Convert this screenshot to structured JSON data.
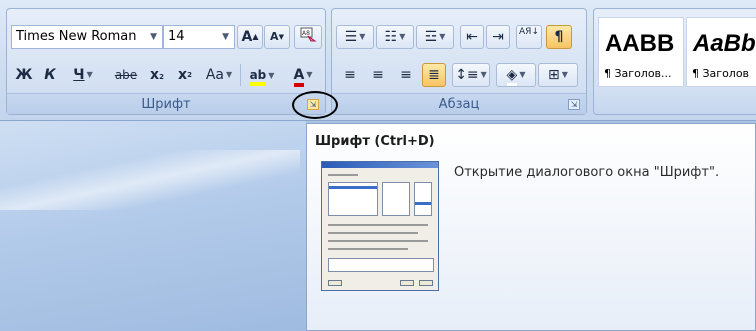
{
  "font_group": {
    "label": "Шрифт",
    "font_name": "Times New Roman",
    "font_size": "14",
    "grow_font": "A",
    "shrink_font": "A",
    "clear_format_icon": "clear-formatting-icon",
    "bold": "Ж",
    "italic": "К",
    "underline": "Ч",
    "strikethrough": "abe",
    "subscript": "x",
    "superscript": "x",
    "change_case": "Aa",
    "highlight": "ab",
    "font_color": "A"
  },
  "paragraph_group": {
    "label": "Абзац",
    "bullets_icon": "bullets-icon",
    "numbering_icon": "numbering-icon",
    "multilevel_icon": "multilevel-list-icon",
    "decrease_indent_icon": "decrease-indent-icon",
    "increase_indent_icon": "increase-indent-icon",
    "sort": "АЯ",
    "show_marks": "¶",
    "align_left_icon": "align-left-icon",
    "align_center_icon": "align-center-icon",
    "align_right_icon": "align-right-icon",
    "justify_icon": "justify-icon",
    "line_spacing_icon": "line-spacing-icon",
    "shading_icon": "shading-icon",
    "borders_icon": "borders-icon"
  },
  "styles_group": {
    "tiles": [
      {
        "sample": "AABB",
        "caption": "¶ Заголов..."
      },
      {
        "sample": "AaBb",
        "caption": "¶ Заголов"
      }
    ]
  },
  "tooltip": {
    "title": "Шрифт (Ctrl+D)",
    "description": "Открытие диалогового окна \"Шрифт\"."
  },
  "colors": {
    "highlight": "#ffff00",
    "font_color": "#d60000",
    "accent": "#3b5a8c"
  }
}
